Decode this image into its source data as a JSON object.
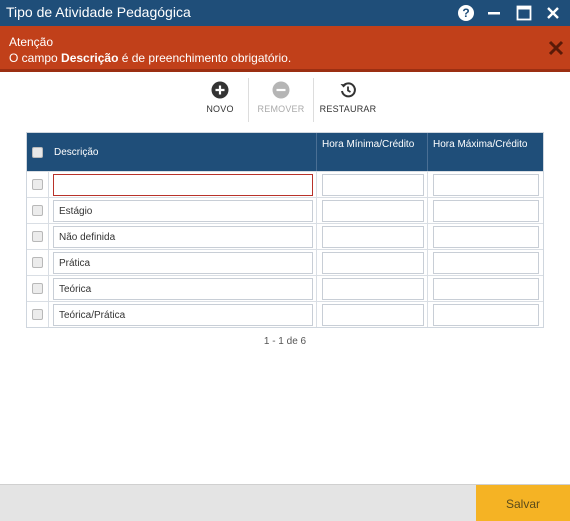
{
  "window": {
    "title": "Tipo de Atividade Pedagógica",
    "help_glyph": "?"
  },
  "alert": {
    "heading": "Atenção",
    "message_prefix": "O campo ",
    "message_field": "Descrição",
    "message_suffix": " é de preenchimento obrigatório."
  },
  "toolbar": {
    "new_label": "NOVO",
    "remove_label": "REMOVER",
    "restore_label": "RESTAURAR"
  },
  "grid": {
    "columns": {
      "description": "Descrição",
      "min_hours": "Hora Mínima/Crédito",
      "max_hours": "Hora Máxima/Crédito"
    },
    "rows": [
      {
        "description": "",
        "min_hours": "",
        "max_hours": ""
      },
      {
        "description": "Estágio",
        "min_hours": "",
        "max_hours": ""
      },
      {
        "description": "Não definida",
        "min_hours": "",
        "max_hours": ""
      },
      {
        "description": "Prática",
        "min_hours": "",
        "max_hours": ""
      },
      {
        "description": "Teórica",
        "min_hours": "",
        "max_hours": ""
      },
      {
        "description": "Teórica/Prática",
        "min_hours": "",
        "max_hours": ""
      }
    ],
    "pagination": "1 - 1 de 6"
  },
  "footer": {
    "save_label": "Salvar"
  },
  "colors": {
    "titlebar": "#1f4e79",
    "alert": "#c1401a",
    "save_button": "#f5b324"
  }
}
